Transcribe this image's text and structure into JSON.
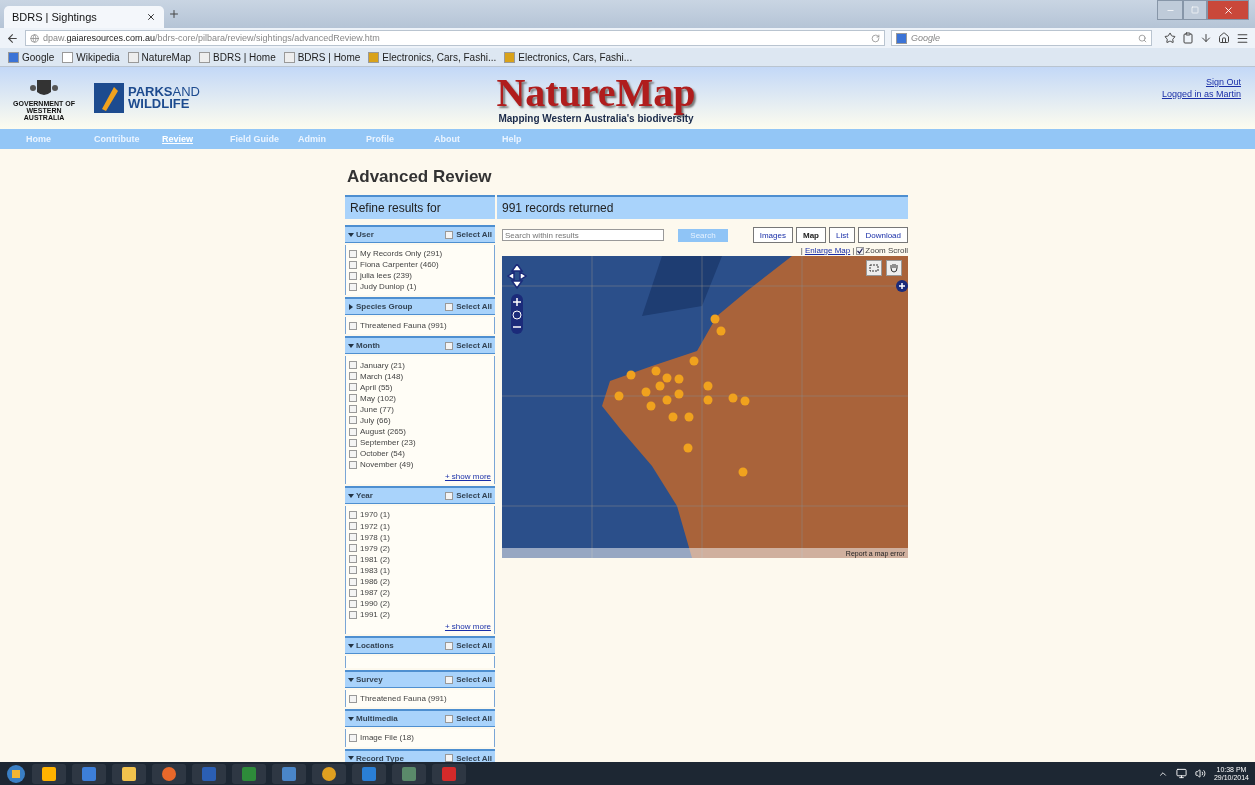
{
  "browser": {
    "tabs": [
      {
        "label": "BDRS | Sightings",
        "selected": true
      }
    ],
    "url": "dpaw.**gaiaresources.com.au**/bdrs-core/pilbara/review/sightings/advancedReview.htm",
    "search": {
      "placeholder": "Google"
    },
    "bookmarks": [
      "Google",
      "Wikipedia",
      "NatureMap",
      "BDRS | Home",
      "BDRS | Home",
      "Electronics, Cars, Fashi...",
      "Electronics, Cars, Fashi..."
    ]
  },
  "site_header": {
    "gov_caption": "GOVERNMENT OF WESTERN AUSTRALIA",
    "brand_bold": "PARKS",
    "brand_light": "AND",
    "brand_line2": "WILDLIFE",
    "title": "NatureMap",
    "subtitle": "Mapping Western Australia's biodiversity",
    "user_links": [
      "Sign Out",
      "Logged in as Martin"
    ]
  },
  "nav": [
    {
      "label": "Home",
      "selected": false
    },
    {
      "label": "Contribute",
      "selected": false
    },
    {
      "label": "Review",
      "selected": true
    },
    {
      "label": "Field Guide",
      "selected": false
    },
    {
      "label": "Admin",
      "selected": false
    },
    {
      "label": "Profile",
      "selected": false
    },
    {
      "label": "About",
      "selected": false
    },
    {
      "label": "Help",
      "selected": false
    }
  ],
  "page_title": "Advanced Review",
  "refine_heading": "Refine results for",
  "results_heading": "991 records returned",
  "facets": [
    {
      "title": "User",
      "expanded": true,
      "select_all": "Select All",
      "select_all_checked": false,
      "items": [
        {
          "label": "My Records Only (291)",
          "checked": false
        },
        {
          "label": "Fiona Carpenter (460)",
          "checked": false
        },
        {
          "label": "julia lees (239)",
          "checked": false
        },
        {
          "label": "Judy Dunlop (1)",
          "checked": false
        }
      ]
    },
    {
      "title": "Species Group",
      "expanded": false,
      "select_all": "Select All",
      "select_all_checked": false,
      "items": [
        {
          "label": "Threatened Fauna (991)",
          "checked": false
        }
      ]
    },
    {
      "title": "Month",
      "expanded": true,
      "select_all": "Select All",
      "select_all_checked": false,
      "items": [
        {
          "label": "January (21)",
          "checked": false
        },
        {
          "label": "March (148)",
          "checked": false
        },
        {
          "label": "April (55)",
          "checked": false
        },
        {
          "label": "May (102)",
          "checked": false
        },
        {
          "label": "June (77)",
          "checked": false
        },
        {
          "label": "July (66)",
          "checked": false
        },
        {
          "label": "August (265)",
          "checked": false
        },
        {
          "label": "September (23)",
          "checked": false
        },
        {
          "label": "October (54)",
          "checked": false
        },
        {
          "label": "November (49)",
          "checked": false
        }
      ],
      "show_more": "+ show more"
    },
    {
      "title": "Year",
      "expanded": true,
      "select_all": "Select All",
      "select_all_checked": false,
      "items": [
        {
          "label": "1970 (1)",
          "checked": false
        },
        {
          "label": "1972 (1)",
          "checked": false
        },
        {
          "label": "1978 (1)",
          "checked": false
        },
        {
          "label": "1979 (2)",
          "checked": false
        },
        {
          "label": "1981 (2)",
          "checked": false
        },
        {
          "label": "1983 (1)",
          "checked": false
        },
        {
          "label": "1986 (2)",
          "checked": false
        },
        {
          "label": "1987 (2)",
          "checked": false
        },
        {
          "label": "1990 (2)",
          "checked": false
        },
        {
          "label": "1991 (2)",
          "checked": false
        }
      ],
      "show_more": "+ show more"
    },
    {
      "title": "Locations",
      "expanded": true,
      "select_all": "Select All",
      "select_all_checked": false
    },
    {
      "title": "Survey",
      "expanded": true,
      "select_all": "Select All",
      "select_all_checked": false,
      "items": [
        {
          "label": "Threatened Fauna (991)",
          "checked": false
        }
      ]
    },
    {
      "title": "Multimedia",
      "expanded": true,
      "select_all": "Select All",
      "select_all_checked": false,
      "items": [
        {
          "label": "Image File (18)",
          "checked": false
        }
      ]
    },
    {
      "title": "Record Type",
      "expanded": true,
      "select_all": "Select All",
      "select_all_checked": false
    }
  ],
  "results_search": {
    "placeholder": "Search within results",
    "button": "Search"
  },
  "views": [
    {
      "label": "Images",
      "selected": false
    },
    {
      "label": "Map",
      "selected": true
    },
    {
      "label": "List",
      "selected": false
    },
    {
      "label": "Download",
      "selected": false
    }
  ],
  "map_options": {
    "separator": "|",
    "enlarge": "Enlarge Map",
    "separator_2": "|",
    "zoom_scroll": "Zoom Scroll",
    "zoom_scroll_checked": true
  },
  "map": {
    "report": "Report a map error"
  },
  "taskbar": {
    "time": "10:38 PM",
    "date": "29/10/2014"
  }
}
